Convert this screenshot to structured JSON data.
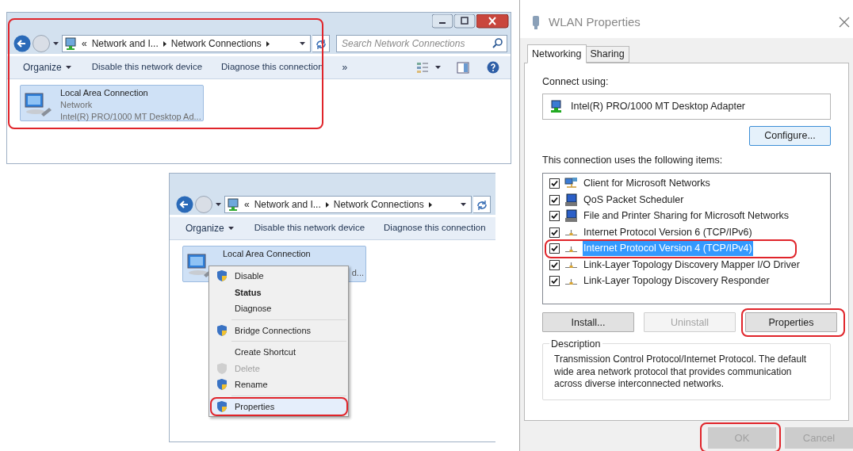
{
  "explorer_window": {
    "highlighted": true,
    "address": {
      "prefix": "«",
      "crumbs": [
        "Network and I...",
        "Network Connections"
      ]
    },
    "search": {
      "placeholder": "Search Network Connections"
    },
    "toolbar": [
      {
        "label": "Organize",
        "kind": "dropdown"
      },
      {
        "label": "Disable this network device",
        "kind": "action"
      },
      {
        "label": "Diagnose this connection",
        "kind": "action"
      },
      {
        "label": "»",
        "kind": "overflow"
      }
    ],
    "connection": {
      "name": "Local Area Connection",
      "status": "Network",
      "device": "Intel(R) PRO/1000 MT Desktop Ad..."
    }
  },
  "explorer_context_window": {
    "address": {
      "prefix": "«",
      "crumbs": [
        "Network and I...",
        "Network Connections"
      ]
    },
    "toolbar": [
      {
        "label": "Organize",
        "kind": "dropdown"
      },
      {
        "label": "Disable this network device",
        "kind": "action"
      },
      {
        "label": "Diagnose this connection",
        "kind": "action"
      }
    ],
    "connection": {
      "name": "Local Area Connection",
      "device": "d..."
    },
    "context_menu": {
      "groups": [
        {
          "items": [
            {
              "label": "Disable",
              "kind": "shield",
              "default": false,
              "disabled": false,
              "highlighted": false
            },
            {
              "label": "Status",
              "kind": "plain",
              "default": true,
              "disabled": false,
              "highlighted": false
            },
            {
              "label": "Diagnose",
              "kind": "plain",
              "default": false,
              "disabled": false,
              "highlighted": false
            }
          ]
        },
        {
          "items": [
            {
              "label": "Bridge Connections",
              "kind": "shield",
              "default": false,
              "disabled": false,
              "highlighted": false
            }
          ]
        },
        {
          "items": [
            {
              "label": "Create Shortcut",
              "kind": "plain",
              "default": false,
              "disabled": false,
              "highlighted": false
            },
            {
              "label": "Delete",
              "kind": "shield",
              "default": false,
              "disabled": true,
              "highlighted": false
            },
            {
              "label": "Rename",
              "kind": "shield",
              "default": false,
              "disabled": false,
              "highlighted": false
            }
          ]
        },
        {
          "items": [
            {
              "label": "Properties",
              "kind": "shield",
              "default": false,
              "disabled": false,
              "highlighted": true
            }
          ]
        }
      ]
    }
  },
  "properties_dialog": {
    "title": "WLAN Properties",
    "tabs": [
      {
        "label": "Networking",
        "selected": true
      },
      {
        "label": "Sharing",
        "selected": false
      }
    ],
    "connect_using_label": "Connect using:",
    "adapter": "Intel(R) PRO/1000 MT Desktop Adapter",
    "configure_button": "Configure...",
    "items_label": "This connection uses the following items:",
    "items": [
      {
        "label": "Client for Microsoft Networks",
        "kind": "client",
        "checked": true,
        "selected": false,
        "highlighted": false
      },
      {
        "label": "QoS Packet Scheduler",
        "kind": "service",
        "checked": true,
        "selected": false,
        "highlighted": false
      },
      {
        "label": "File and Printer Sharing for Microsoft Networks",
        "kind": "service",
        "checked": true,
        "selected": false,
        "highlighted": false
      },
      {
        "label": "Internet Protocol Version 6 (TCP/IPv6)",
        "kind": "protocol",
        "checked": true,
        "selected": false,
        "highlighted": false
      },
      {
        "label": "Internet Protocol Version 4 (TCP/IPv4)",
        "kind": "protocol",
        "checked": true,
        "selected": true,
        "highlighted": true
      },
      {
        "label": "Link-Layer Topology Discovery Mapper I/O Driver",
        "kind": "protocol",
        "checked": true,
        "selected": false,
        "highlighted": false
      },
      {
        "label": "Link-Layer Topology Discovery Responder",
        "kind": "protocol",
        "checked": true,
        "selected": false,
        "highlighted": false
      }
    ],
    "item_buttons": [
      {
        "label": "Install...",
        "disabled": false,
        "highlighted": false
      },
      {
        "label": "Uninstall",
        "disabled": true,
        "highlighted": false
      },
      {
        "label": "Properties",
        "disabled": false,
        "highlighted": true
      }
    ],
    "description": {
      "legend": "Description",
      "text": "Transmission Control Protocol/Internet Protocol. The default wide area network protocol that provides communication across diverse interconnected networks."
    },
    "footer_buttons": [
      {
        "label": "OK",
        "disabled": true,
        "highlighted": true
      },
      {
        "label": "Cancel",
        "disabled": true,
        "highlighted": false
      }
    ]
  }
}
